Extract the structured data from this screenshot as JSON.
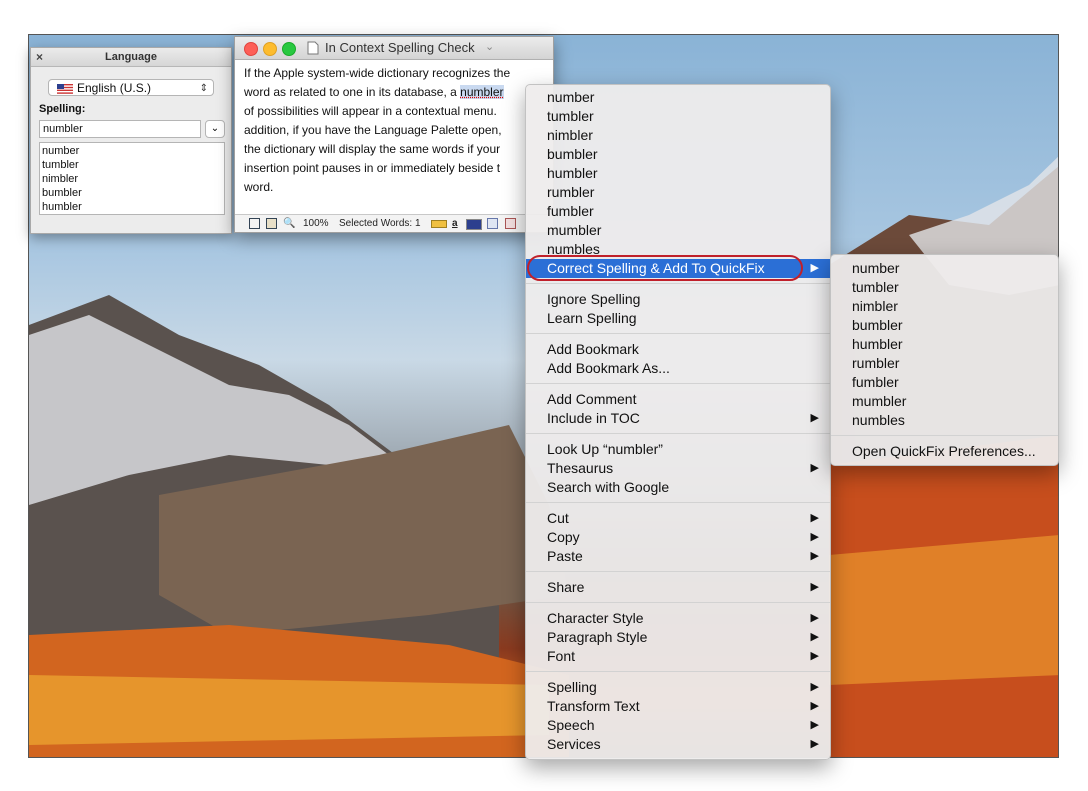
{
  "language_palette": {
    "title": "Language",
    "close": "×",
    "language": "English (U.S.)",
    "spelling_label": "Spelling:",
    "spelling_value": "numbler",
    "suggestions": [
      "number",
      "tumbler",
      "nimbler",
      "bumbler",
      "humbler"
    ]
  },
  "document": {
    "title": "In Context Spelling Check",
    "lines": [
      "If the Apple system-wide dictionary recognizes the",
      "word as related to one in its database, a ",
      "of possibilities will appear in a contextual menu.",
      "addition, if you have the Language Palette open,",
      "the dictionary will display the same words if your",
      "insertion point pauses in or immediately beside t",
      "word."
    ],
    "selected_word": "numbler",
    "zoom": "100%",
    "selected_words": "Selected Words: 1"
  },
  "context_menu": {
    "suggestions": [
      "number",
      "tumbler",
      "nimbler",
      "bumbler",
      "humbler",
      "rumbler",
      "fumbler",
      "mumbler",
      "numbles"
    ],
    "correct_spelling": "Correct Spelling & Add To QuickFix",
    "ignore_spelling": "Ignore Spelling",
    "learn_spelling": "Learn Spelling",
    "add_bookmark": "Add Bookmark",
    "add_bookmark_as": "Add Bookmark As...",
    "add_comment": "Add Comment",
    "include_toc": "Include in TOC",
    "look_up": "Look Up “numbler”",
    "thesaurus": "Thesaurus",
    "search_google": "Search with Google",
    "cut": "Cut",
    "copy": "Copy",
    "paste": "Paste",
    "share": "Share",
    "character_style": "Character Style",
    "paragraph_style": "Paragraph Style",
    "font": "Font",
    "spelling": "Spelling",
    "transform_text": "Transform Text",
    "speech": "Speech",
    "services": "Services",
    "submenu_arrow": "▶"
  },
  "submenu": {
    "suggestions": [
      "number",
      "tumbler",
      "nimbler",
      "bumbler",
      "humbler",
      "rumbler",
      "fumbler",
      "mumbler",
      "numbles"
    ],
    "open_prefs": "Open QuickFix Preferences..."
  },
  "colors": {
    "highlight": "#2b6fd6",
    "annotation_ring": "#c0202a"
  }
}
